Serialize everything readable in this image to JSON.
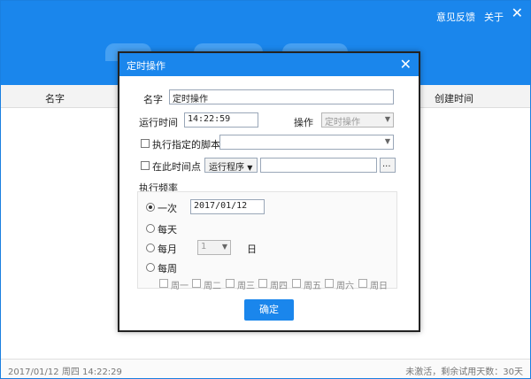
{
  "topbar": {
    "feedback": "意见反馈",
    "about": "关于",
    "close": "✕"
  },
  "list": {
    "col_name": "名字",
    "col_created": "创建时间"
  },
  "status": {
    "left": "2017/01/12  周四  14:22:29",
    "right": "未激活，剩余试用天数：30天"
  },
  "dialog": {
    "title": "定时操作",
    "close": "✕",
    "name_label": "名字",
    "name_value": "定时操作",
    "run_time_label": "运行时间",
    "run_time_value": "14:22:59",
    "action_label": "操作",
    "action_value": "定时操作",
    "exec_script_label": "执行指定的脚本",
    "at_time_label": "在此时间点",
    "run_program_button": "运行程序",
    "browse_button": "...",
    "freq_label": "执行频率",
    "freq_once": "一次",
    "once_date": "2017/01/12",
    "freq_daily": "每天",
    "freq_monthly": "每月",
    "month_day_value": "1",
    "day_unit": "日",
    "freq_weekly": "每周",
    "weekdays": [
      "周一",
      "周二",
      "周三",
      "周四",
      "周五",
      "周六",
      "周日"
    ],
    "ok_button": "确定"
  }
}
